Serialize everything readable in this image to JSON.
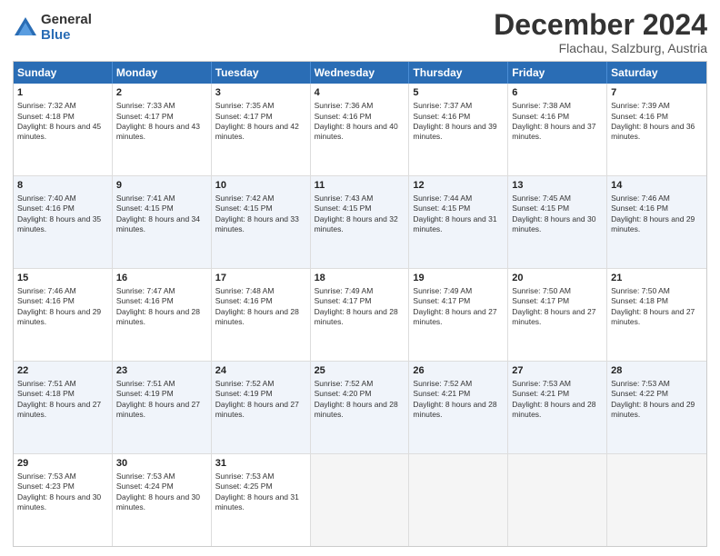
{
  "logo": {
    "general": "General",
    "blue": "Blue"
  },
  "title": "December 2024",
  "subtitle": "Flachau, Salzburg, Austria",
  "header_days": [
    "Sunday",
    "Monday",
    "Tuesday",
    "Wednesday",
    "Thursday",
    "Friday",
    "Saturday"
  ],
  "weeks": [
    [
      {
        "day": "1",
        "sunrise": "7:32 AM",
        "sunset": "4:18 PM",
        "daylight": "8 hours and 45 minutes."
      },
      {
        "day": "2",
        "sunrise": "7:33 AM",
        "sunset": "4:17 PM",
        "daylight": "8 hours and 43 minutes."
      },
      {
        "day": "3",
        "sunrise": "7:35 AM",
        "sunset": "4:17 PM",
        "daylight": "8 hours and 42 minutes."
      },
      {
        "day": "4",
        "sunrise": "7:36 AM",
        "sunset": "4:16 PM",
        "daylight": "8 hours and 40 minutes."
      },
      {
        "day": "5",
        "sunrise": "7:37 AM",
        "sunset": "4:16 PM",
        "daylight": "8 hours and 39 minutes."
      },
      {
        "day": "6",
        "sunrise": "7:38 AM",
        "sunset": "4:16 PM",
        "daylight": "8 hours and 37 minutes."
      },
      {
        "day": "7",
        "sunrise": "7:39 AM",
        "sunset": "4:16 PM",
        "daylight": "8 hours and 36 minutes."
      }
    ],
    [
      {
        "day": "8",
        "sunrise": "7:40 AM",
        "sunset": "4:16 PM",
        "daylight": "8 hours and 35 minutes."
      },
      {
        "day": "9",
        "sunrise": "7:41 AM",
        "sunset": "4:15 PM",
        "daylight": "8 hours and 34 minutes."
      },
      {
        "day": "10",
        "sunrise": "7:42 AM",
        "sunset": "4:15 PM",
        "daylight": "8 hours and 33 minutes."
      },
      {
        "day": "11",
        "sunrise": "7:43 AM",
        "sunset": "4:15 PM",
        "daylight": "8 hours and 32 minutes."
      },
      {
        "day": "12",
        "sunrise": "7:44 AM",
        "sunset": "4:15 PM",
        "daylight": "8 hours and 31 minutes."
      },
      {
        "day": "13",
        "sunrise": "7:45 AM",
        "sunset": "4:15 PM",
        "daylight": "8 hours and 30 minutes."
      },
      {
        "day": "14",
        "sunrise": "7:46 AM",
        "sunset": "4:16 PM",
        "daylight": "8 hours and 29 minutes."
      }
    ],
    [
      {
        "day": "15",
        "sunrise": "7:46 AM",
        "sunset": "4:16 PM",
        "daylight": "8 hours and 29 minutes."
      },
      {
        "day": "16",
        "sunrise": "7:47 AM",
        "sunset": "4:16 PM",
        "daylight": "8 hours and 28 minutes."
      },
      {
        "day": "17",
        "sunrise": "7:48 AM",
        "sunset": "4:16 PM",
        "daylight": "8 hours and 28 minutes."
      },
      {
        "day": "18",
        "sunrise": "7:49 AM",
        "sunset": "4:17 PM",
        "daylight": "8 hours and 28 minutes."
      },
      {
        "day": "19",
        "sunrise": "7:49 AM",
        "sunset": "4:17 PM",
        "daylight": "8 hours and 27 minutes."
      },
      {
        "day": "20",
        "sunrise": "7:50 AM",
        "sunset": "4:17 PM",
        "daylight": "8 hours and 27 minutes."
      },
      {
        "day": "21",
        "sunrise": "7:50 AM",
        "sunset": "4:18 PM",
        "daylight": "8 hours and 27 minutes."
      }
    ],
    [
      {
        "day": "22",
        "sunrise": "7:51 AM",
        "sunset": "4:18 PM",
        "daylight": "8 hours and 27 minutes."
      },
      {
        "day": "23",
        "sunrise": "7:51 AM",
        "sunset": "4:19 PM",
        "daylight": "8 hours and 27 minutes."
      },
      {
        "day": "24",
        "sunrise": "7:52 AM",
        "sunset": "4:19 PM",
        "daylight": "8 hours and 27 minutes."
      },
      {
        "day": "25",
        "sunrise": "7:52 AM",
        "sunset": "4:20 PM",
        "daylight": "8 hours and 28 minutes."
      },
      {
        "day": "26",
        "sunrise": "7:52 AM",
        "sunset": "4:21 PM",
        "daylight": "8 hours and 28 minutes."
      },
      {
        "day": "27",
        "sunrise": "7:53 AM",
        "sunset": "4:21 PM",
        "daylight": "8 hours and 28 minutes."
      },
      {
        "day": "28",
        "sunrise": "7:53 AM",
        "sunset": "4:22 PM",
        "daylight": "8 hours and 29 minutes."
      }
    ],
    [
      {
        "day": "29",
        "sunrise": "7:53 AM",
        "sunset": "4:23 PM",
        "daylight": "8 hours and 30 minutes."
      },
      {
        "day": "30",
        "sunrise": "7:53 AM",
        "sunset": "4:24 PM",
        "daylight": "8 hours and 30 minutes."
      },
      {
        "day": "31",
        "sunrise": "7:53 AM",
        "sunset": "4:25 PM",
        "daylight": "8 hours and 31 minutes."
      },
      null,
      null,
      null,
      null
    ]
  ],
  "labels": {
    "sunrise": "Sunrise:",
    "sunset": "Sunset:",
    "daylight": "Daylight:"
  }
}
